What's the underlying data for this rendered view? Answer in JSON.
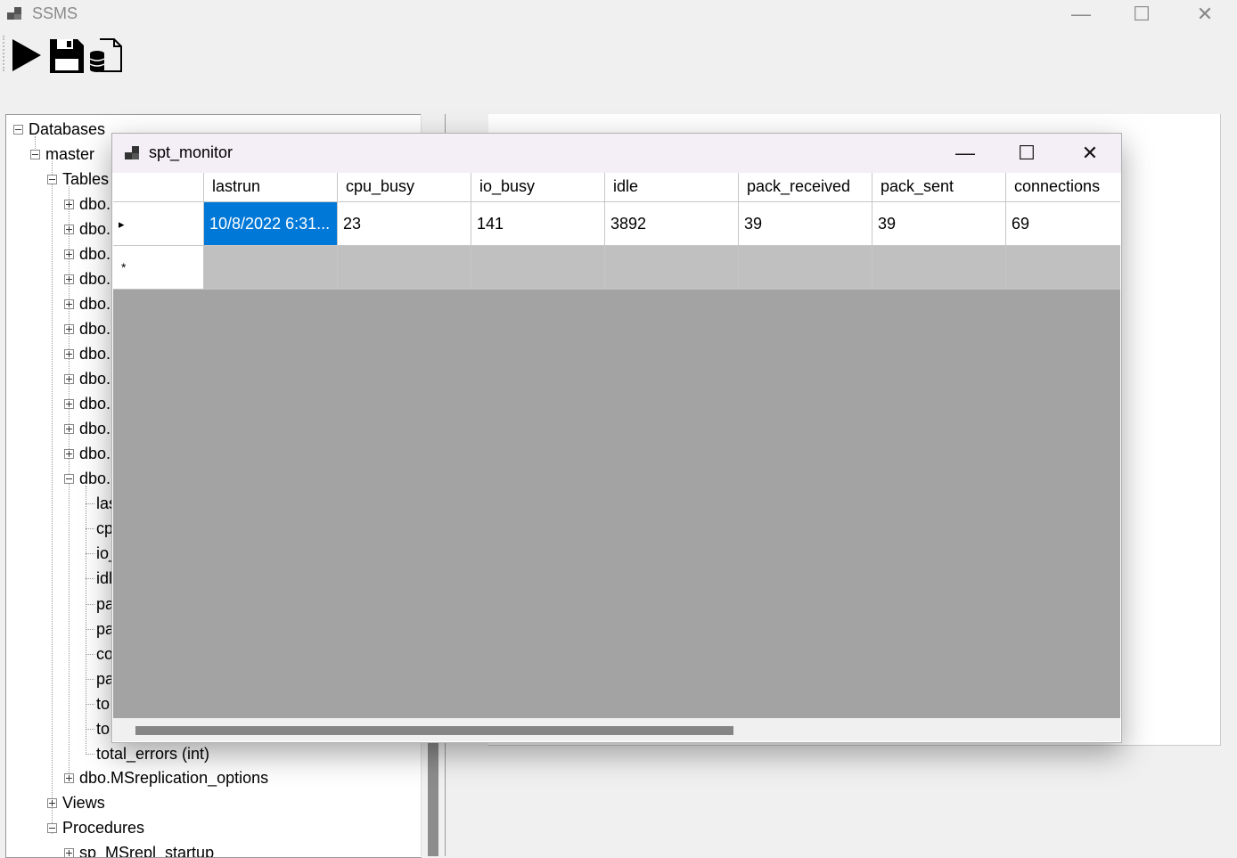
{
  "app": {
    "title": "SSMS"
  },
  "window_controls": {
    "minimize": "—",
    "maximize": "☐",
    "close": "✕"
  },
  "toolbar": {
    "run_icon": "play-icon",
    "save_icon": "save-icon",
    "new_query_icon": "database-document-icon"
  },
  "tree": {
    "root": "Databases",
    "db": "master",
    "tables": "Tables",
    "table_items": [
      "dbo.",
      "dbo.",
      "dbo.",
      "dbo.",
      "dbo.",
      "dbo.",
      "dbo.",
      "dbo.",
      "dbo.",
      "dbo.",
      "dbo."
    ],
    "expanded_table": "dbo.",
    "columns": [
      "las",
      "cp",
      "io_",
      "idl",
      "pa",
      "pa",
      "co",
      "pa",
      "to",
      "to",
      "total_errors (int)"
    ],
    "after_tables": "dbo.MSreplication_options",
    "views": "Views",
    "procedures": "Procedures",
    "proc_item": "sp_MSrepl_startup"
  },
  "child_window": {
    "title": "spt_monitor",
    "controls": {
      "minimize": "—",
      "maximize": "☐",
      "close": "✕"
    }
  },
  "grid": {
    "columns": [
      "lastrun",
      "cpu_busy",
      "io_busy",
      "idle",
      "pack_received",
      "pack_sent",
      "connections"
    ],
    "rows": [
      {
        "indicator": "▸",
        "cells": [
          "10/8/2022 6:31...",
          "23",
          "141",
          "3892",
          "39",
          "39",
          "69"
        ]
      }
    ],
    "new_row_indicator": "*"
  },
  "colors": {
    "selection": "#0078d7",
    "grid_bg": "#a3a3a3",
    "child_title_bg": "#f4eef7"
  }
}
